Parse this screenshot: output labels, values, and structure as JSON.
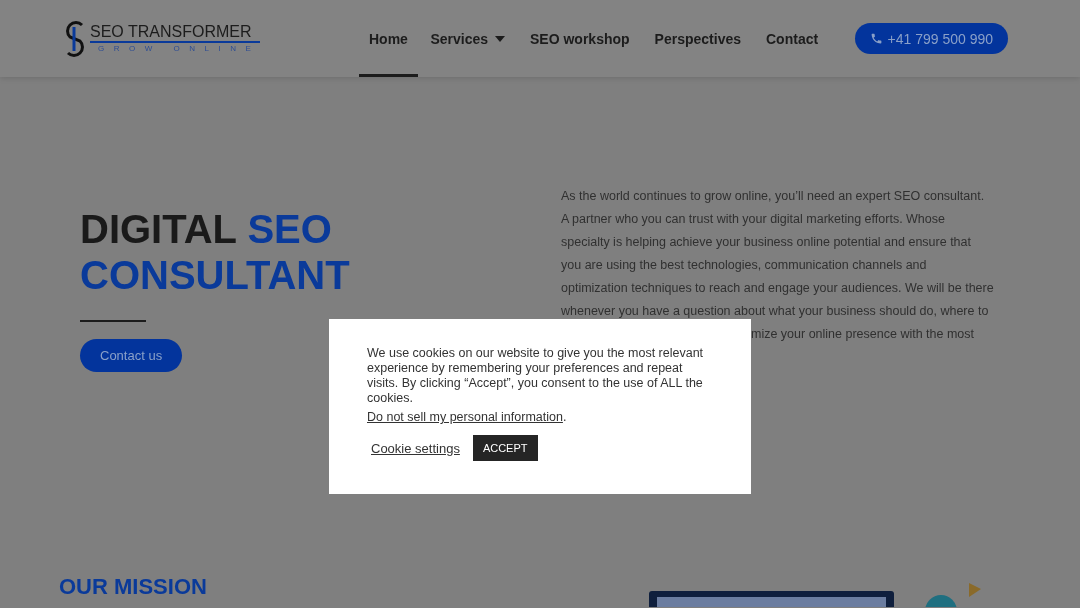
{
  "header": {
    "logo": {
      "title": "SEO TRANSFORMER",
      "tagline": "GROW ONLINE"
    },
    "nav": [
      {
        "label": "Home",
        "selected": true,
        "dropdown": false
      },
      {
        "label": "Services",
        "selected": false,
        "dropdown": true
      },
      {
        "label": "SEO workshop",
        "selected": false,
        "dropdown": false
      },
      {
        "label": "Perspectives",
        "selected": false,
        "dropdown": false
      },
      {
        "label": "Contact",
        "selected": false,
        "dropdown": false
      }
    ],
    "phone_button": "+41 799 500 990"
  },
  "hero": {
    "heading_dark": "DIGITAL",
    "heading_blue_1": "SEO",
    "heading_blue_2": "CONSULTANT",
    "button": "Contact us",
    "paragraph_lines": [
      "As the world continues to grow online, you’ll need an expert SEO consultant.",
      "A partner who you can trust with your digital marketing efforts. Whose",
      "specialty is helping achieve your business online potential and ensure that",
      "you are using the best technologies, communication channels and",
      "optimization techniques to reach and engage your audiences. We will be there",
      "whenever you have a question about what your business should do, where to"
    ],
    "paragraph_tail": "mize your online presence with the most"
  },
  "cookie_dialog": {
    "message": "We use cookies on our website to give you the most relevant experience by remembering your preferences and repeat visits. By clicking “Accept”, you consent to the use of ALL the cookies.",
    "link": "Do not sell my personal information",
    "link_suffix": ".",
    "settings": "Cookie settings",
    "accept": "ACCEPT"
  },
  "mission": {
    "kicker": "OUR MISSION"
  }
}
